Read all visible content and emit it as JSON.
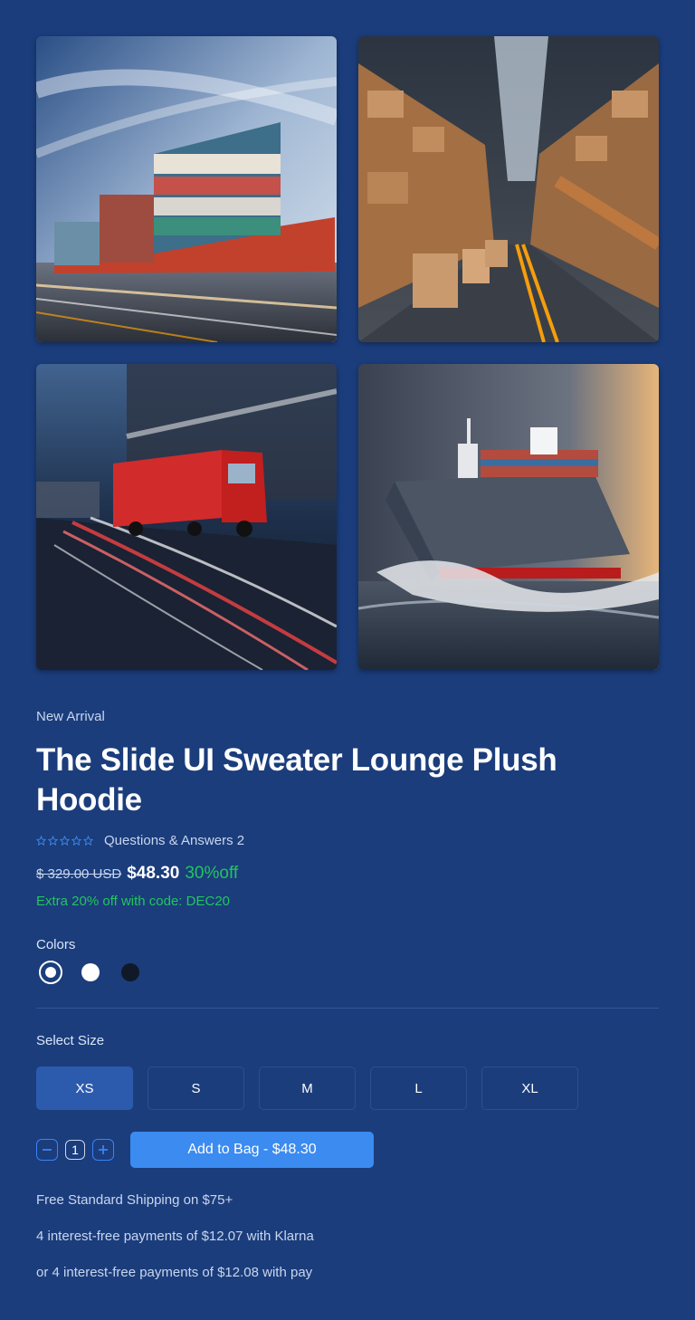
{
  "product": {
    "eyebrow": "New Arrival",
    "title": "The Slide UI Sweater Lounge Plush Hoodie",
    "rating": 0,
    "qa_link": "Questions & Answers 2",
    "old_price": "$ 329.00 USD",
    "price": "$48.30",
    "discount": "30%off",
    "promo": "Extra 20% off with code: DEC20"
  },
  "gallery": [
    {
      "icon": "container-ship-photo"
    },
    {
      "icon": "warehouse-photo"
    },
    {
      "icon": "truck-photo"
    },
    {
      "icon": "cargo-ship-waves-photo"
    }
  ],
  "colors": {
    "label": "Colors",
    "options": [
      {
        "name": "selected",
        "hex": "#ffffff"
      },
      {
        "name": "white",
        "hex": "#ffffff"
      },
      {
        "name": "black",
        "hex": "#111827"
      }
    ]
  },
  "sizes": {
    "label": "Select Size",
    "options": [
      "XS",
      "S",
      "M",
      "L",
      "XL"
    ],
    "selected": "XS"
  },
  "cart": {
    "quantity": "1",
    "add_label": "Add to Bag - $48.30"
  },
  "info": {
    "shipping": "Free Standard Shipping on $75+",
    "klarna": "4 interest-free payments of $12.07 with Klarna",
    "pay": "or 4 interest-free payments of $12.08 with pay"
  },
  "theme": {
    "background": "#1b3d7c",
    "accent": "#3b8bf0",
    "success": "#22c55e",
    "size_active": "#2c5bae"
  }
}
